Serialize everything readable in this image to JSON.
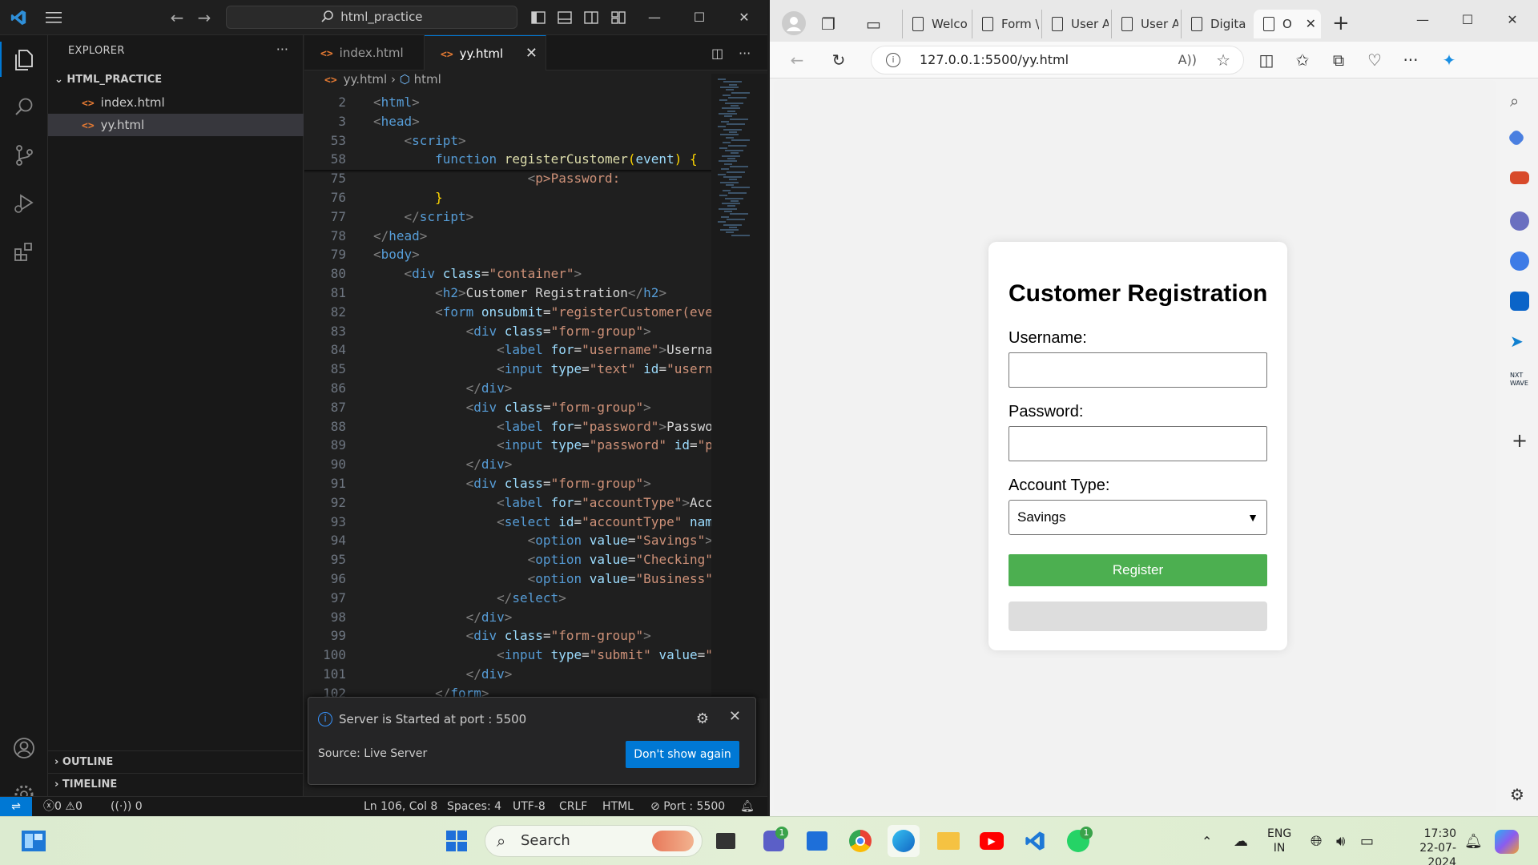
{
  "vscode": {
    "command_center": "html_practice",
    "sidebar": {
      "title": "EXPLORER",
      "folder": "HTML_PRACTICE",
      "files": [
        "index.html",
        "yy.html"
      ],
      "sections": [
        "OUTLINE",
        "TIMELINE"
      ]
    },
    "tabs": [
      {
        "label": "index.html"
      },
      {
        "label": "yy.html"
      }
    ],
    "breadcrumb": {
      "file": "yy.html",
      "element": "html"
    },
    "code_lines": [
      {
        "n": "2",
        "segs": [
          [
            "tg",
            "<"
          ],
          [
            "tn",
            "html"
          ],
          [
            "tg",
            ">"
          ]
        ]
      },
      {
        "n": "3",
        "segs": [
          [
            "tg",
            "<"
          ],
          [
            "tn",
            "head"
          ],
          [
            "tg",
            ">"
          ]
        ]
      },
      {
        "n": "53",
        "segs": [
          [
            "pl",
            "    "
          ],
          [
            "tg",
            "<"
          ],
          [
            "tn",
            "script"
          ],
          [
            "tg",
            ">"
          ]
        ]
      },
      {
        "n": "58",
        "segs": [
          [
            "pl",
            "        "
          ],
          [
            "kw",
            "function "
          ],
          [
            "fn",
            "registerCustomer"
          ],
          [
            "br",
            "("
          ],
          [
            "at",
            "event"
          ],
          [
            "br",
            ")"
          ],
          [
            "pl",
            " "
          ],
          [
            "br",
            "{"
          ]
        ]
      },
      {
        "n": "75",
        "segs": [
          [
            "pl",
            "                    "
          ],
          [
            "tg",
            "<"
          ],
          [
            "st",
            "p>Password:"
          ]
        ]
      },
      {
        "n": "76",
        "segs": [
          [
            "pl",
            "        "
          ],
          [
            "br",
            "}"
          ]
        ]
      },
      {
        "n": "77",
        "segs": [
          [
            "pl",
            "    "
          ],
          [
            "tg",
            "</"
          ],
          [
            "tn",
            "script"
          ],
          [
            "tg",
            ">"
          ]
        ]
      },
      {
        "n": "78",
        "segs": [
          [
            "tg",
            "</"
          ],
          [
            "tn",
            "head"
          ],
          [
            "tg",
            ">"
          ]
        ]
      },
      {
        "n": "79",
        "segs": [
          [
            "tg",
            "<"
          ],
          [
            "tn",
            "body"
          ],
          [
            "tg",
            ">"
          ]
        ]
      },
      {
        "n": "80",
        "segs": [
          [
            "pl",
            "    "
          ],
          [
            "tg",
            "<"
          ],
          [
            "tn",
            "div "
          ],
          [
            "at",
            "class"
          ],
          [
            "pl",
            "="
          ],
          [
            "st",
            "\"container\""
          ],
          [
            "tg",
            ">"
          ]
        ]
      },
      {
        "n": "81",
        "segs": [
          [
            "pl",
            "        "
          ],
          [
            "tg",
            "<"
          ],
          [
            "tn",
            "h2"
          ],
          [
            "tg",
            ">"
          ],
          [
            "pl",
            "Customer Registration"
          ],
          [
            "tg",
            "</"
          ],
          [
            "tn",
            "h2"
          ],
          [
            "tg",
            ">"
          ]
        ]
      },
      {
        "n": "82",
        "segs": [
          [
            "pl",
            "        "
          ],
          [
            "tg",
            "<"
          ],
          [
            "tn",
            "form "
          ],
          [
            "at",
            "onsubmit"
          ],
          [
            "pl",
            "="
          ],
          [
            "st",
            "\"registerCustomer(eve"
          ]
        ]
      },
      {
        "n": "83",
        "segs": [
          [
            "pl",
            "            "
          ],
          [
            "tg",
            "<"
          ],
          [
            "tn",
            "div "
          ],
          [
            "at",
            "class"
          ],
          [
            "pl",
            "="
          ],
          [
            "st",
            "\"form-group\""
          ],
          [
            "tg",
            ">"
          ]
        ]
      },
      {
        "n": "84",
        "segs": [
          [
            "pl",
            "                "
          ],
          [
            "tg",
            "<"
          ],
          [
            "tn",
            "label "
          ],
          [
            "at",
            "for"
          ],
          [
            "pl",
            "="
          ],
          [
            "st",
            "\"username\""
          ],
          [
            "tg",
            ">"
          ],
          [
            "pl",
            "Userna"
          ]
        ]
      },
      {
        "n": "85",
        "segs": [
          [
            "pl",
            "                "
          ],
          [
            "tg",
            "<"
          ],
          [
            "tn",
            "input "
          ],
          [
            "at",
            "type"
          ],
          [
            "pl",
            "="
          ],
          [
            "st",
            "\"text\""
          ],
          [
            "pl",
            " "
          ],
          [
            "at",
            "id"
          ],
          [
            "pl",
            "="
          ],
          [
            "st",
            "\"usern"
          ]
        ]
      },
      {
        "n": "86",
        "segs": [
          [
            "pl",
            "            "
          ],
          [
            "tg",
            "</"
          ],
          [
            "tn",
            "div"
          ],
          [
            "tg",
            ">"
          ]
        ]
      },
      {
        "n": "87",
        "segs": [
          [
            "pl",
            "            "
          ],
          [
            "tg",
            "<"
          ],
          [
            "tn",
            "div "
          ],
          [
            "at",
            "class"
          ],
          [
            "pl",
            "="
          ],
          [
            "st",
            "\"form-group\""
          ],
          [
            "tg",
            ">"
          ]
        ]
      },
      {
        "n": "88",
        "segs": [
          [
            "pl",
            "                "
          ],
          [
            "tg",
            "<"
          ],
          [
            "tn",
            "label "
          ],
          [
            "at",
            "for"
          ],
          [
            "pl",
            "="
          ],
          [
            "st",
            "\"password\""
          ],
          [
            "tg",
            ">"
          ],
          [
            "pl",
            "Passwo"
          ]
        ]
      },
      {
        "n": "89",
        "segs": [
          [
            "pl",
            "                "
          ],
          [
            "tg",
            "<"
          ],
          [
            "tn",
            "input "
          ],
          [
            "at",
            "type"
          ],
          [
            "pl",
            "="
          ],
          [
            "st",
            "\"password\""
          ],
          [
            "pl",
            " "
          ],
          [
            "at",
            "id"
          ],
          [
            "pl",
            "="
          ],
          [
            "st",
            "\"p"
          ]
        ]
      },
      {
        "n": "90",
        "segs": [
          [
            "pl",
            "            "
          ],
          [
            "tg",
            "</"
          ],
          [
            "tn",
            "div"
          ],
          [
            "tg",
            ">"
          ]
        ]
      },
      {
        "n": "91",
        "segs": [
          [
            "pl",
            "            "
          ],
          [
            "tg",
            "<"
          ],
          [
            "tn",
            "div "
          ],
          [
            "at",
            "class"
          ],
          [
            "pl",
            "="
          ],
          [
            "st",
            "\"form-group\""
          ],
          [
            "tg",
            ">"
          ]
        ]
      },
      {
        "n": "92",
        "segs": [
          [
            "pl",
            "                "
          ],
          [
            "tg",
            "<"
          ],
          [
            "tn",
            "label "
          ],
          [
            "at",
            "for"
          ],
          [
            "pl",
            "="
          ],
          [
            "st",
            "\"accountType\""
          ],
          [
            "tg",
            ">"
          ],
          [
            "pl",
            "Acc"
          ]
        ]
      },
      {
        "n": "93",
        "segs": [
          [
            "pl",
            "                "
          ],
          [
            "tg",
            "<"
          ],
          [
            "tn",
            "select "
          ],
          [
            "at",
            "id"
          ],
          [
            "pl",
            "="
          ],
          [
            "st",
            "\"accountType\""
          ],
          [
            "pl",
            " "
          ],
          [
            "at",
            "nam"
          ]
        ]
      },
      {
        "n": "94",
        "segs": [
          [
            "pl",
            "                    "
          ],
          [
            "tg",
            "<"
          ],
          [
            "tn",
            "option "
          ],
          [
            "at",
            "value"
          ],
          [
            "pl",
            "="
          ],
          [
            "st",
            "\"Savings\""
          ],
          [
            "tg",
            ">"
          ]
        ]
      },
      {
        "n": "95",
        "segs": [
          [
            "pl",
            "                    "
          ],
          [
            "tg",
            "<"
          ],
          [
            "tn",
            "option "
          ],
          [
            "at",
            "value"
          ],
          [
            "pl",
            "="
          ],
          [
            "st",
            "\"Checking\""
          ]
        ]
      },
      {
        "n": "96",
        "segs": [
          [
            "pl",
            "                    "
          ],
          [
            "tg",
            "<"
          ],
          [
            "tn",
            "option "
          ],
          [
            "at",
            "value"
          ],
          [
            "pl",
            "="
          ],
          [
            "st",
            "\"Business\""
          ]
        ]
      },
      {
        "n": "97",
        "segs": [
          [
            "pl",
            "                "
          ],
          [
            "tg",
            "</"
          ],
          [
            "tn",
            "select"
          ],
          [
            "tg",
            ">"
          ]
        ]
      },
      {
        "n": "98",
        "segs": [
          [
            "pl",
            "            "
          ],
          [
            "tg",
            "</"
          ],
          [
            "tn",
            "div"
          ],
          [
            "tg",
            ">"
          ]
        ]
      },
      {
        "n": "99",
        "segs": [
          [
            "pl",
            "            "
          ],
          [
            "tg",
            "<"
          ],
          [
            "tn",
            "div "
          ],
          [
            "at",
            "class"
          ],
          [
            "pl",
            "="
          ],
          [
            "st",
            "\"form-group\""
          ],
          [
            "tg",
            ">"
          ]
        ]
      },
      {
        "n": "100",
        "segs": [
          [
            "pl",
            "                "
          ],
          [
            "tg",
            "<"
          ],
          [
            "tn",
            "input "
          ],
          [
            "at",
            "type"
          ],
          [
            "pl",
            "="
          ],
          [
            "st",
            "\"submit\""
          ],
          [
            "pl",
            " "
          ],
          [
            "at",
            "value"
          ],
          [
            "pl",
            "="
          ],
          [
            "st",
            "\""
          ]
        ]
      },
      {
        "n": "101",
        "segs": [
          [
            "pl",
            "            "
          ],
          [
            "tg",
            "</"
          ],
          [
            "tn",
            "div"
          ],
          [
            "tg",
            ">"
          ]
        ]
      },
      {
        "n": "102",
        "segs": [
          [
            "pl",
            "        "
          ],
          [
            "tg",
            "</"
          ],
          [
            "tn",
            "form"
          ],
          [
            "tg",
            ">"
          ]
        ]
      }
    ],
    "notification": {
      "message": "Server is Started at port : 5500",
      "source": "Source: Live Server",
      "button": "Don't show again"
    },
    "status": {
      "errors": "0",
      "warnings": "0",
      "ports": "0",
      "position": "Ln 106, Col 8",
      "spaces": "Spaces: 4",
      "encoding": "UTF-8",
      "eol": "CRLF",
      "language": "HTML",
      "port": "Port : 5500"
    }
  },
  "edge": {
    "tabs": [
      "Welco",
      "Form \\",
      "User A",
      "User A",
      "Digita",
      "O"
    ],
    "address": "127.0.0.1:5500/yy.html",
    "form": {
      "title": "Customer Registration",
      "username_label": "Username:",
      "password_label": "Password:",
      "account_label": "Account Type:",
      "account_selected": "Savings",
      "submit": "Register"
    },
    "accent_submit": "#4caf50"
  },
  "taskbar": {
    "search": "Search",
    "teams_badge": "1",
    "whatsapp_badge": "1",
    "lang_line1": "ENG",
    "lang_line2": "IN",
    "time": "17:30",
    "date": "22-07-2024"
  }
}
